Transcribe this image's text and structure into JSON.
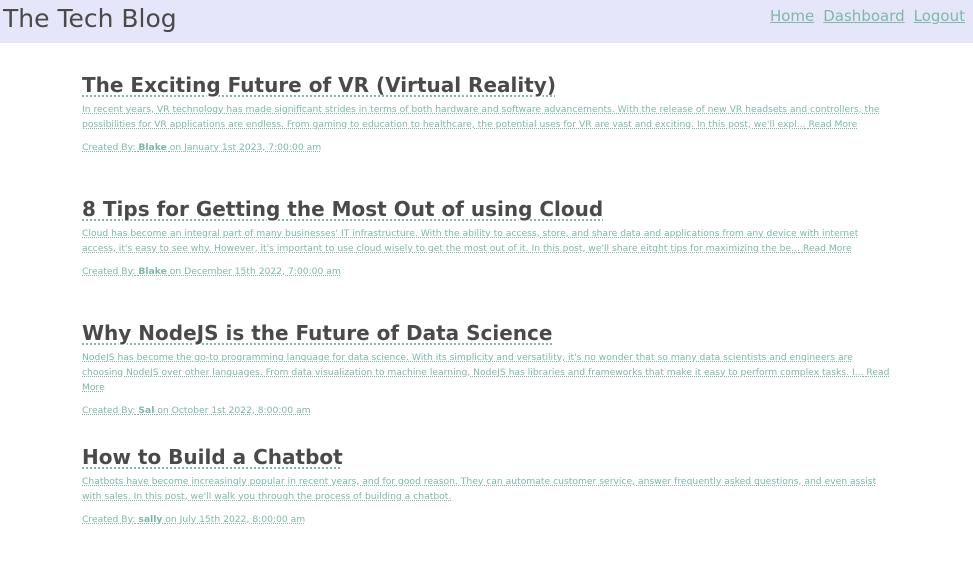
{
  "header": {
    "title": "The Tech Blog",
    "nav": [
      {
        "label": "Home"
      },
      {
        "label": "Dashboard"
      },
      {
        "label": "Logout"
      }
    ]
  },
  "posts": [
    {
      "title": "The Exciting Future of VR (Virtual Reality)",
      "excerpt": "In recent years, VR technology has made significant strides in terms of both hardware and software advancements. With the release of new VR headsets and controllers, the possibilities for VR applications are endless. From gaming to education to healthcare, the potential uses for VR are vast and exciting. In this post, we'll expl...",
      "read_more": "Read More",
      "created_by_label": "Created By:",
      "author": "Blake",
      "date": "on January 1st 2023, 7:00:00 am"
    },
    {
      "title": "8 Tips for Getting the Most Out of using Cloud",
      "excerpt": "Cloud has become an integral part of many businesses' IT infrastructure. With the ability to access, store, and share data and applications from any device with internet access, it's easy to see why. However, it's important to use cloud wisely to get the most out of it. In this post, we'll share eitght tips for maximizing the be...",
      "read_more": "Read More",
      "created_by_label": "Created By:",
      "author": "Blake",
      "date": "on December 15th 2022, 7:00:00 am"
    },
    {
      "title": "Why NodeJS is the Future of Data Science",
      "excerpt": "NodeJS has become the go-to programming language for data science. With its simplicity and versatility, it's no wonder that so many data scientists and engineers are choosing NodeJS over other languages. From data visualization to machine learning, NodeJS has libraries and frameworks that make it easy to perform complex tasks. I...",
      "read_more": "Read More",
      "created_by_label": "Created By:",
      "author": "Sal",
      "date": "on October 1st 2022, 8:00:00 am"
    },
    {
      "title": "How to Build a Chatbot",
      "excerpt": "Chatbots have become increasingly popular in recent years, and for good reason. They can automate customer service, answer frequently asked questions, and even assist with sales. In this post, we'll walk you through the process of building a chatbot.",
      "read_more": "",
      "created_by_label": "Created By:",
      "author": "sally",
      "date": "on July 15th 2022, 8:00:00 am"
    }
  ],
  "colors": {
    "header_bg": "#e6e6fa",
    "accent": "#7fb8a6",
    "title_text": "#4a4a4a"
  }
}
